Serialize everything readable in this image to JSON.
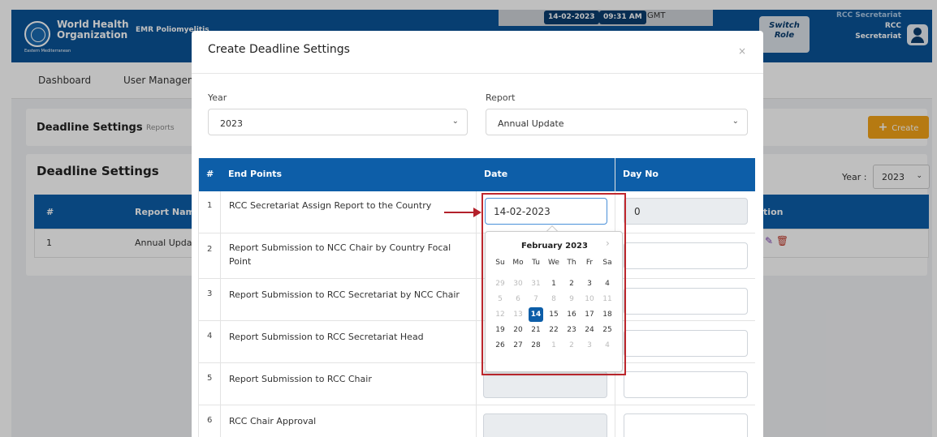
{
  "header": {
    "org_name": "World Health\nOrganization",
    "org_region": "Eastern Mediterranean",
    "app_name": "EMR Poliomyelitis",
    "date": "14-02-2023",
    "time": "09:31 AM",
    "timezone": "GMT",
    "switch_role": "Switch\nRole",
    "user_role_line1": "RCC Secretariat",
    "user_name_line1": "RCC",
    "user_name_line2": "Secretariat"
  },
  "nav": {
    "dashboard": "Dashboard",
    "user_management": "User Management"
  },
  "breadcrumb": {
    "title": "Deadline Settings",
    "sub": "Reports"
  },
  "create_button": "Create",
  "main": {
    "title": "Deadline Settings",
    "year_label": "Year :",
    "year_value": "2023",
    "table_headers": [
      "#",
      "Report Name",
      "Action"
    ],
    "rows": [
      {
        "num": "1",
        "report": "Annual Update"
      }
    ]
  },
  "modal": {
    "title": "Create Deadline Settings",
    "close": "×",
    "year_label": "Year",
    "year_value": "2023",
    "report_label": "Report",
    "report_value": "Annual Update",
    "headers": [
      "#",
      "End Points",
      "Date",
      "Day No"
    ],
    "rows": [
      {
        "num": "1",
        "endpoint": "RCC Secretariat Assign Report to the Country",
        "date": "14-02-2023",
        "day": "0"
      },
      {
        "num": "2",
        "endpoint": "Report Submission to NCC Chair by Country Focal Point",
        "date": "",
        "day": ""
      },
      {
        "num": "3",
        "endpoint": "Report Submission to RCC Secretariat by NCC Chair",
        "date": "",
        "day": ""
      },
      {
        "num": "4",
        "endpoint": "Report Submission to RCC Secretariat Head",
        "date": "",
        "day": ""
      },
      {
        "num": "5",
        "endpoint": "Report Submission to RCC Chair",
        "date": "",
        "day": ""
      },
      {
        "num": "6",
        "endpoint": "RCC Chair Approval",
        "date": "",
        "day": ""
      }
    ]
  },
  "calendar": {
    "month": "February 2023",
    "next": "›",
    "dow": [
      "Su",
      "Mo",
      "Tu",
      "We",
      "Th",
      "Fr",
      "Sa"
    ],
    "weeks": [
      [
        "29",
        "30",
        "31",
        "1",
        "2",
        "3",
        "4"
      ],
      [
        "5",
        "6",
        "7",
        "8",
        "9",
        "10",
        "11"
      ],
      [
        "12",
        "13",
        "14",
        "15",
        "16",
        "17",
        "18"
      ],
      [
        "19",
        "20",
        "21",
        "22",
        "23",
        "24",
        "25"
      ],
      [
        "26",
        "27",
        "28",
        "1",
        "2",
        "3",
        "4"
      ]
    ],
    "selected": "14",
    "colors": {
      "accent": "#0d5ea8",
      "highlight": "#c0282e"
    }
  }
}
